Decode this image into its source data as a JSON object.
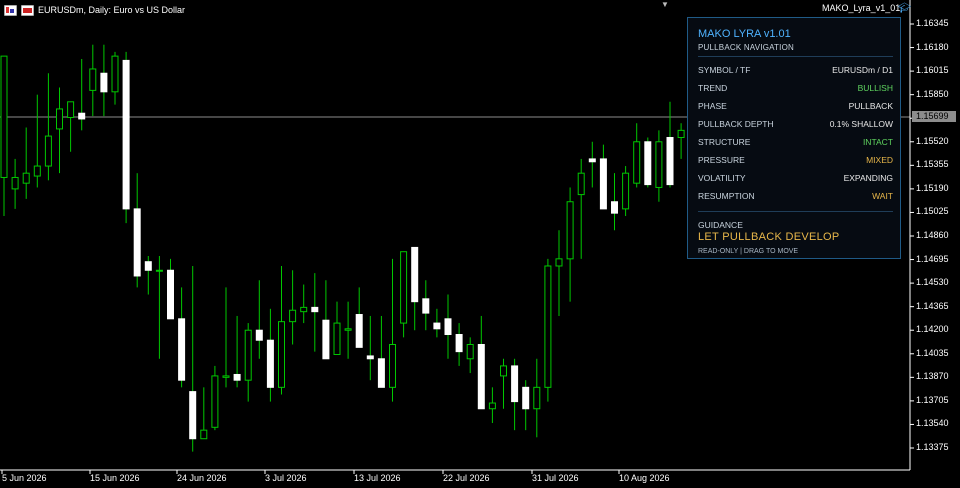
{
  "header": {
    "symbol_text": "EURUSDm, Daily:  Euro vs US Dollar",
    "ea_name": "MAKO_Lyra_v1_01"
  },
  "panel": {
    "title": "MAKO LYRA v1.01",
    "subtitle": "PULLBACK NAVIGATION",
    "rows": [
      {
        "key": "SYMBOL / TF",
        "value": "EURUSDm / D1",
        "color": "#e8e8e8"
      },
      {
        "key": "TREND",
        "value": "BULLISH",
        "color": "#5fd45f"
      },
      {
        "key": "PHASE",
        "value": "PULLBACK",
        "color": "#e8e8e8"
      },
      {
        "key": "PULLBACK DEPTH",
        "value": "0.1%  SHALLOW",
        "color": "#e8e8e8"
      },
      {
        "key": "STRUCTURE",
        "value": "INTACT",
        "color": "#5fd45f"
      },
      {
        "key": "PRESSURE",
        "value": "MIXED",
        "color": "#e8b74a"
      },
      {
        "key": "VOLATILITY",
        "value": "EXPANDING",
        "color": "#e8e8e8"
      },
      {
        "key": "RESUMPTION",
        "value": "WAIT",
        "color": "#e8b74a"
      }
    ],
    "guidance_label": "GUIDANCE",
    "guidance_value": "LET PULLBACK DEVELOP",
    "footer": "READ-ONLY  |  DRAG TO MOVE"
  },
  "price_axis": {
    "labels": [
      "1.16345",
      "1.16180",
      "1.16015",
      "1.15850",
      "1.15685",
      "1.15520",
      "1.15355",
      "1.15190",
      "1.15025",
      "1.14860",
      "1.14695",
      "1.14530",
      "1.14365",
      "1.14200",
      "1.14035",
      "1.13870",
      "1.13705",
      "1.13540",
      "1.13375"
    ],
    "current_price": "1.15699"
  },
  "time_axis": {
    "labels": [
      "5 Jun 2026",
      "15 Jun 2026",
      "24 Jun 2026",
      "3 Jul 2026",
      "13 Jul 2026",
      "22 Jul 2026",
      "31 Jul 2026",
      "10 Aug 2026"
    ]
  },
  "colors": {
    "bull": "#00c800",
    "bear": "#ffffff",
    "wick": "#00c800",
    "price_line": "#8d8d8d",
    "accent": "#4fb3ff"
  },
  "candles": [
    {
      "o": 1.1527,
      "h": 1.161,
      "l": 1.15,
      "c": 1.1612
    },
    {
      "o": 1.1519,
      "h": 1.154,
      "l": 1.1505,
      "c": 1.1527
    },
    {
      "o": 1.1523,
      "h": 1.1562,
      "l": 1.1512,
      "c": 1.153
    },
    {
      "o": 1.1528,
      "h": 1.1585,
      "l": 1.152,
      "c": 1.1535
    },
    {
      "o": 1.1535,
      "h": 1.16,
      "l": 1.1525,
      "c": 1.1556
    },
    {
      "o": 1.1561,
      "h": 1.159,
      "l": 1.153,
      "c": 1.1575
    },
    {
      "o": 1.1569,
      "h": 1.158,
      "l": 1.1545,
      "c": 1.158
    },
    {
      "o": 1.1572,
      "h": 1.161,
      "l": 1.156,
      "c": 1.1568
    },
    {
      "o": 1.1588,
      "h": 1.162,
      "l": 1.157,
      "c": 1.1603
    },
    {
      "o": 1.16,
      "h": 1.162,
      "l": 1.157,
      "c": 1.1587
    },
    {
      "o": 1.1587,
      "h": 1.1615,
      "l": 1.1578,
      "c": 1.1612
    },
    {
      "o": 1.1609,
      "h": 1.1615,
      "l": 1.1495,
      "c": 1.1505
    },
    {
      "o": 1.1505,
      "h": 1.153,
      "l": 1.145,
      "c": 1.1458
    },
    {
      "o": 1.1468,
      "h": 1.1472,
      "l": 1.1445,
      "c": 1.1462
    },
    {
      "o": 1.1462,
      "h": 1.1472,
      "l": 1.14,
      "c": 1.1462
    },
    {
      "o": 1.1462,
      "h": 1.147,
      "l": 1.1435,
      "c": 1.1428
    },
    {
      "o": 1.1428,
      "h": 1.145,
      "l": 1.138,
      "c": 1.1385
    },
    {
      "o": 1.1377,
      "h": 1.1465,
      "l": 1.1335,
      "c": 1.1344
    },
    {
      "o": 1.1344,
      "h": 1.138,
      "l": 1.1345,
      "c": 1.135
    },
    {
      "o": 1.1352,
      "h": 1.1395,
      "l": 1.135,
      "c": 1.1388
    },
    {
      "o": 1.1387,
      "h": 1.145,
      "l": 1.138,
      "c": 1.1388
    },
    {
      "o": 1.1389,
      "h": 1.143,
      "l": 1.138,
      "c": 1.1385
    },
    {
      "o": 1.1385,
      "h": 1.1425,
      "l": 1.137,
      "c": 1.142
    },
    {
      "o": 1.142,
      "h": 1.1455,
      "l": 1.14,
      "c": 1.1413
    },
    {
      "o": 1.1413,
      "h": 1.1435,
      "l": 1.137,
      "c": 1.138
    },
    {
      "o": 1.138,
      "h": 1.1465,
      "l": 1.1375,
      "c": 1.1426
    },
    {
      "o": 1.1426,
      "h": 1.1462,
      "l": 1.141,
      "c": 1.1434
    },
    {
      "o": 1.1433,
      "h": 1.1452,
      "l": 1.1425,
      "c": 1.1436
    },
    {
      "o": 1.1436,
      "h": 1.146,
      "l": 1.1405,
      "c": 1.1433
    },
    {
      "o": 1.1427,
      "h": 1.1455,
      "l": 1.1405,
      "c": 1.14
    },
    {
      "o": 1.1403,
      "h": 1.144,
      "l": 1.141,
      "c": 1.1425
    },
    {
      "o": 1.142,
      "h": 1.144,
      "l": 1.14,
      "c": 1.1421
    },
    {
      "o": 1.1431,
      "h": 1.145,
      "l": 1.1415,
      "c": 1.1408
    },
    {
      "o": 1.1402,
      "h": 1.143,
      "l": 1.1385,
      "c": 1.14
    },
    {
      "o": 1.14,
      "h": 1.143,
      "l": 1.138,
      "c": 1.138
    },
    {
      "o": 1.138,
      "h": 1.147,
      "l": 1.137,
      "c": 1.141
    },
    {
      "o": 1.1425,
      "h": 1.1475,
      "l": 1.1415,
      "c": 1.1475
    },
    {
      "o": 1.1478,
      "h": 1.147,
      "l": 1.142,
      "c": 1.144
    },
    {
      "o": 1.1442,
      "h": 1.1455,
      "l": 1.142,
      "c": 1.1432
    },
    {
      "o": 1.1425,
      "h": 1.1435,
      "l": 1.1415,
      "c": 1.1421
    },
    {
      "o": 1.1428,
      "h": 1.1445,
      "l": 1.14,
      "c": 1.1417
    },
    {
      "o": 1.1417,
      "h": 1.1425,
      "l": 1.1395,
      "c": 1.1405
    },
    {
      "o": 1.14,
      "h": 1.1415,
      "l": 1.139,
      "c": 1.141
    },
    {
      "o": 1.141,
      "h": 1.143,
      "l": 1.1365,
      "c": 1.1365
    },
    {
      "o": 1.1365,
      "h": 1.138,
      "l": 1.1355,
      "c": 1.1369
    },
    {
      "o": 1.1388,
      "h": 1.14,
      "l": 1.1365,
      "c": 1.1395
    },
    {
      "o": 1.1395,
      "h": 1.14,
      "l": 1.135,
      "c": 1.137
    },
    {
      "o": 1.138,
      "h": 1.1385,
      "l": 1.135,
      "c": 1.1365
    },
    {
      "o": 1.1365,
      "h": 1.14,
      "l": 1.1345,
      "c": 1.138
    },
    {
      "o": 1.138,
      "h": 1.147,
      "l": 1.137,
      "c": 1.1465
    },
    {
      "o": 1.1465,
      "h": 1.149,
      "l": 1.143,
      "c": 1.147
    },
    {
      "o": 1.147,
      "h": 1.152,
      "l": 1.144,
      "c": 1.151
    },
    {
      "o": 1.1515,
      "h": 1.154,
      "l": 1.147,
      "c": 1.153
    },
    {
      "o": 1.154,
      "h": 1.1552,
      "l": 1.152,
      "c": 1.1538
    },
    {
      "o": 1.154,
      "h": 1.155,
      "l": 1.1505,
      "c": 1.1505
    },
    {
      "o": 1.151,
      "h": 1.153,
      "l": 1.149,
      "c": 1.1502
    },
    {
      "o": 1.1505,
      "h": 1.1535,
      "l": 1.15,
      "c": 1.153
    },
    {
      "o": 1.1523,
      "h": 1.1565,
      "l": 1.152,
      "c": 1.1552
    },
    {
      "o": 1.1552,
      "h": 1.1555,
      "l": 1.152,
      "c": 1.1522
    },
    {
      "o": 1.152,
      "h": 1.156,
      "l": 1.151,
      "c": 1.1552
    },
    {
      "o": 1.1555,
      "h": 1.158,
      "l": 1.152,
      "c": 1.1522
    },
    {
      "o": 1.1555,
      "h": 1.1565,
      "l": 1.154,
      "c": 1.156
    },
    {
      "o": 1.1555,
      "h": 1.1565,
      "l": 1.153,
      "c": 1.1542
    },
    {
      "o": 1.1545,
      "h": 1.156,
      "l": 1.153,
      "c": 1.1538
    },
    {
      "o": 1.1538,
      "h": 1.156,
      "l": 1.152,
      "c": 1.1522
    },
    {
      "o": 1.1522,
      "h": 1.155,
      "l": 1.152,
      "c": 1.153
    },
    {
      "o": 1.1532,
      "h": 1.159,
      "l": 1.153,
      "c": 1.1575
    }
  ]
}
